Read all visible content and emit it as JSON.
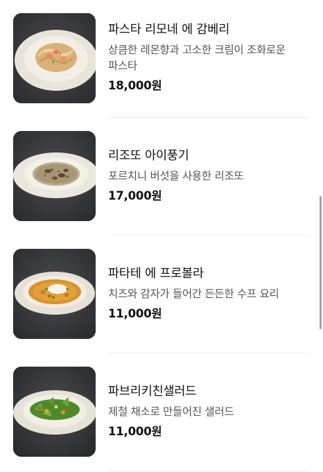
{
  "menu": {
    "items": [
      {
        "name": "파스타 리모네 에 감베리",
        "description": "상큼한 레몬향과 고소한 크림이 조화로운 파스타",
        "price": "18,000원",
        "image": "pasta-dish-photo"
      },
      {
        "name": "리조또 아이풍기",
        "description": "포르치니 버섯을 사용한 리조또",
        "price": "17,000원",
        "image": "risotto-dish-photo"
      },
      {
        "name": "파타테 에 프로볼라",
        "description": "치즈와 감자가 들어간 든든한 수프 요리",
        "price": "11,000원",
        "image": "soup-dish-photo"
      },
      {
        "name": "파브리키친샐러드",
        "description": "제철 채소로 만들어진 샐러드",
        "price": "11,000원",
        "image": "salad-dish-photo"
      }
    ]
  },
  "colors": {
    "background": "#ffffff",
    "plate_surface": "#3a3b3d",
    "text_primary": "#111111",
    "text_secondary": "#555555",
    "divider": "#ededed"
  }
}
